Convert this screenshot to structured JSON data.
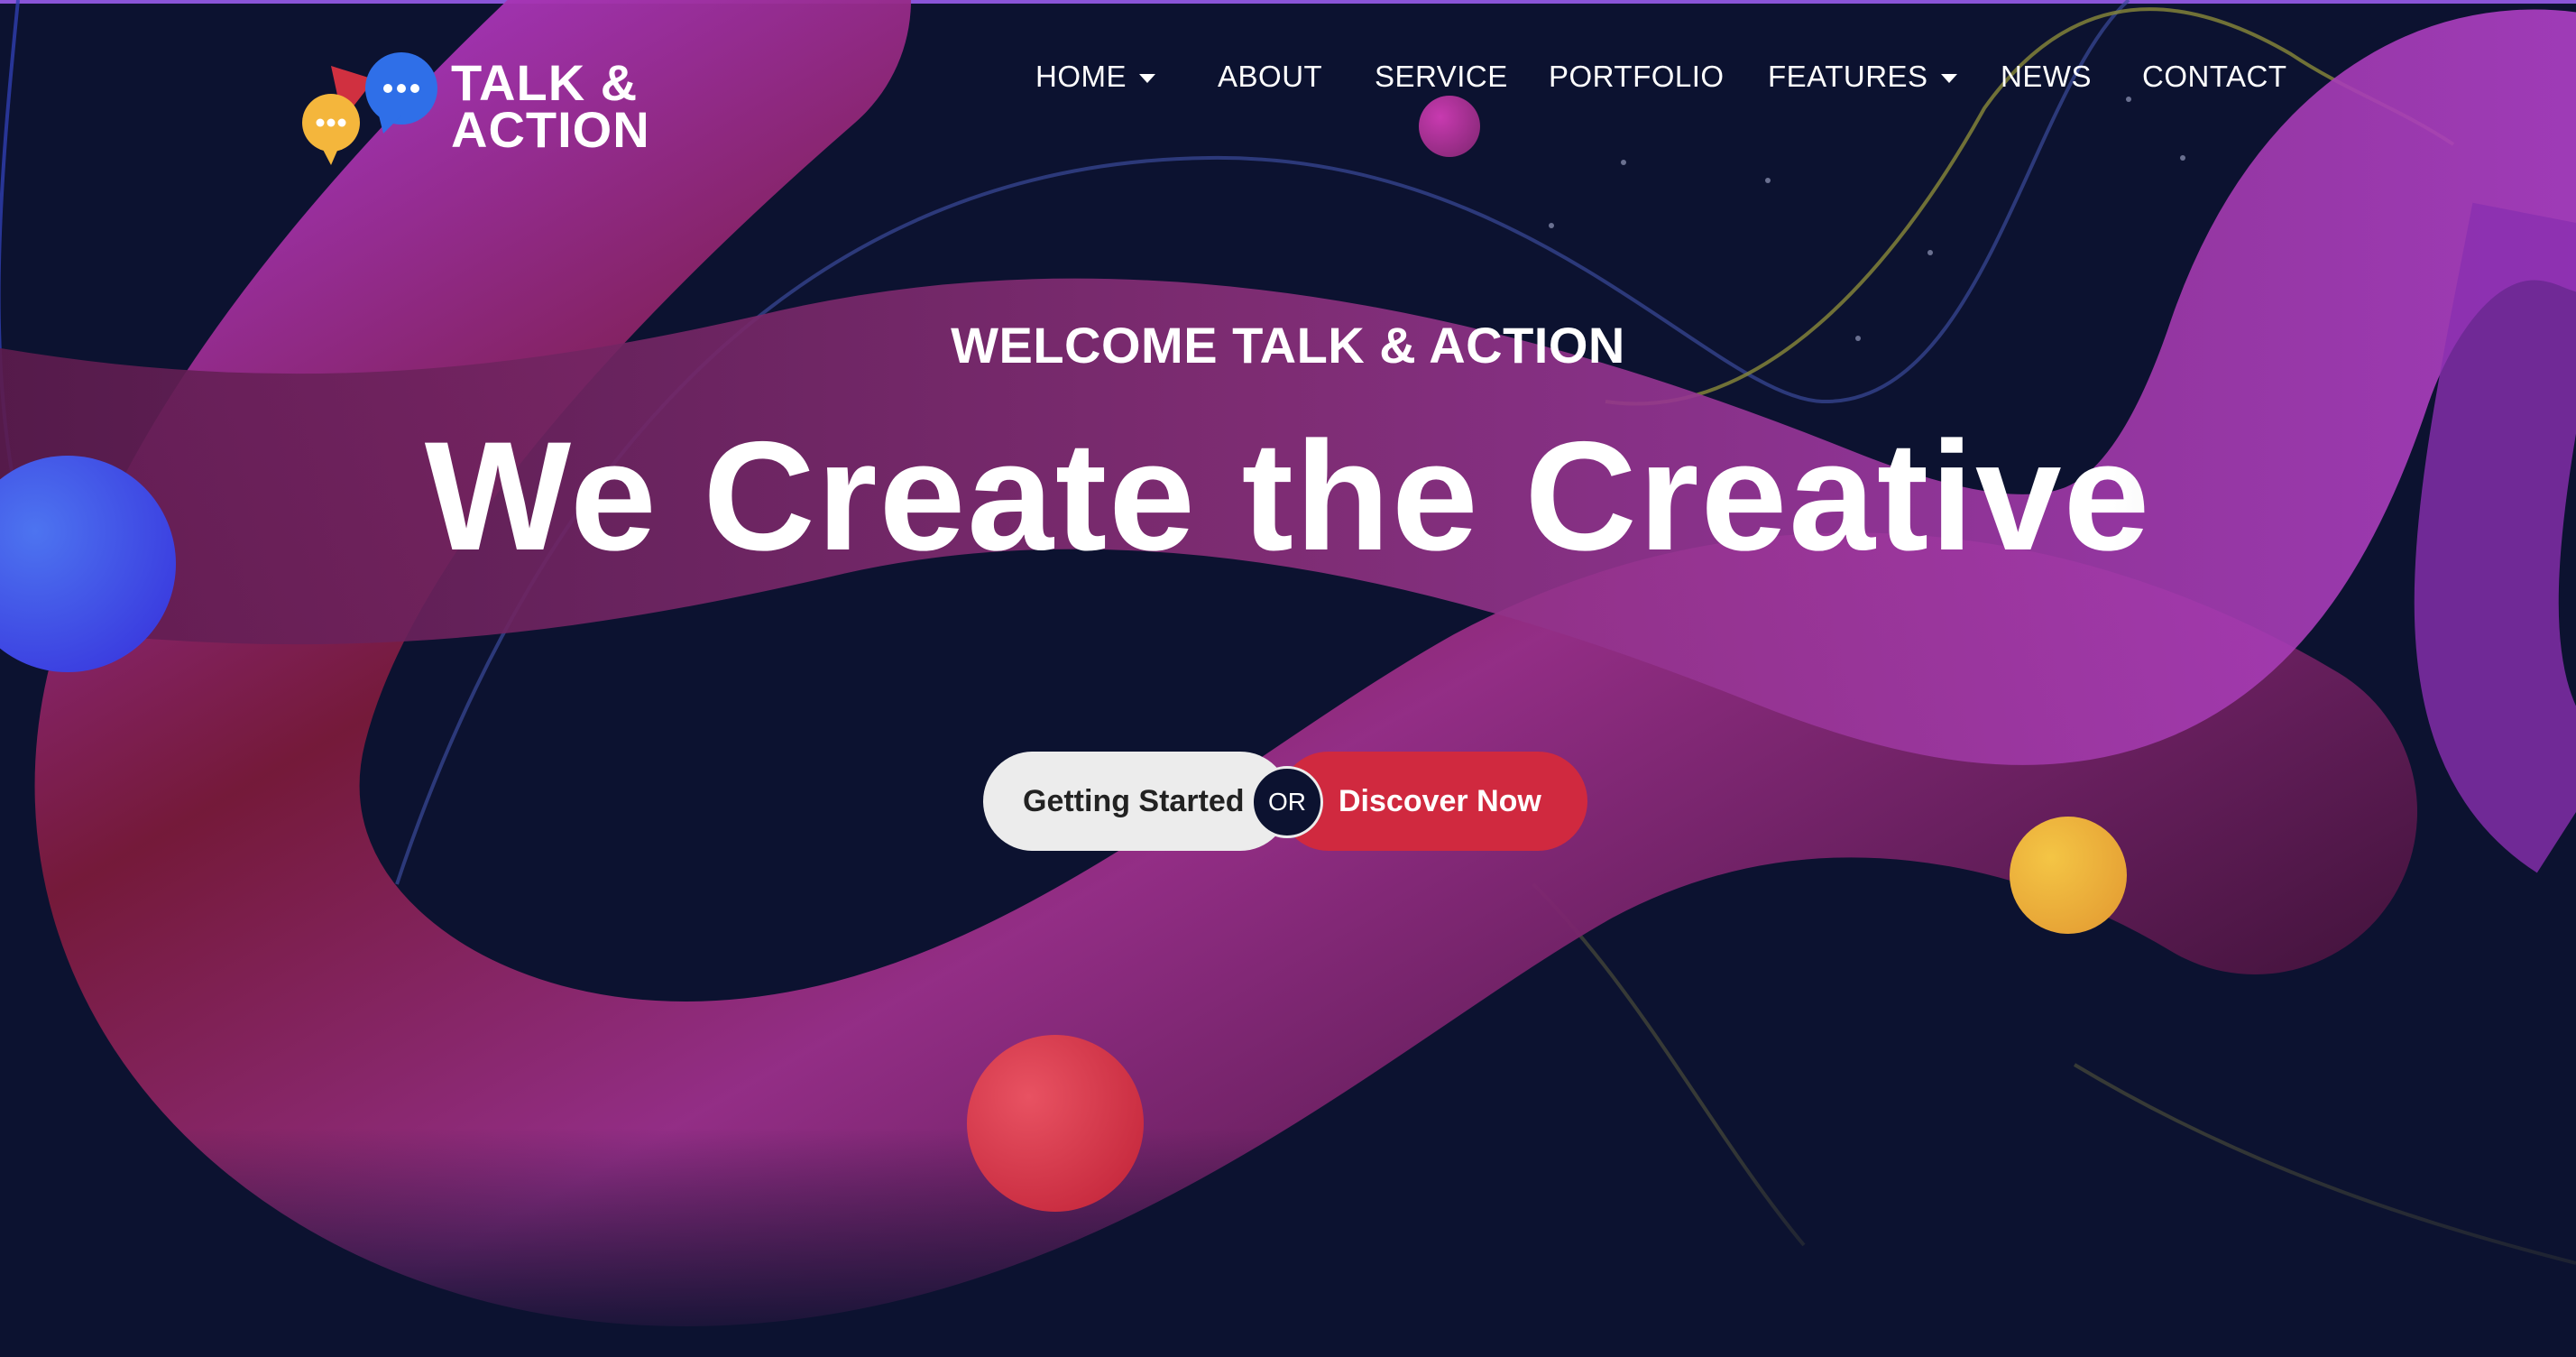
{
  "brand": {
    "line1": "TALK &",
    "line2": "ACTION",
    "icon": "speech-bubbles-logo"
  },
  "nav": {
    "home": "HOME",
    "about": "ABOUT",
    "service": "SERVICE",
    "portfolio": "PORTFOLIO",
    "features": "FEATURES",
    "news": "NEWS",
    "contact": "CONTACT"
  },
  "hero": {
    "welcome": "WELCOME TALK & ACTION",
    "headline": "We Create the Creative",
    "primary_button": "Getting Started",
    "separator": "OR",
    "secondary_button": "Discover Now"
  },
  "colors": {
    "background": "#0c1230",
    "accent_red": "#d0293f",
    "light_button": "#ececec",
    "orb_blue": "#3e55e8",
    "orb_yellow": "#f0b93c",
    "orb_red": "#e04558",
    "orb_magenta": "#b0359e"
  }
}
